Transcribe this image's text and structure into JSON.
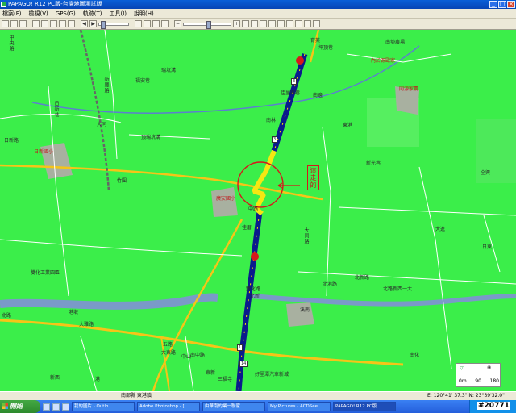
{
  "window": {
    "title": "PAPAGO! R12 PC版-台灣地圖測試版",
    "controls": [
      "minimize",
      "maximize",
      "close"
    ]
  },
  "menu": {
    "items": [
      "檔案(F)",
      "檢視(V)",
      "GPS(G)",
      "軌跡(T)",
      "工具(I)",
      "說明(H)"
    ]
  },
  "map": {
    "labels": [
      {
        "text": "育英",
        "cls": ""
      },
      {
        "text": "中央路",
        "cls": ""
      },
      {
        "text": "頂瑞坑溝",
        "cls": ""
      },
      {
        "text": "新豐路",
        "cls": ""
      },
      {
        "text": "日新路",
        "cls": ""
      },
      {
        "text": "日新國小",
        "cls": "red"
      },
      {
        "text": "日新巷",
        "cls": ""
      },
      {
        "text": "福安巷",
        "cls": ""
      },
      {
        "text": "瑞坑溝",
        "cls": ""
      },
      {
        "text": "坪頂巷",
        "cls": ""
      },
      {
        "text": "大同",
        "cls": ""
      },
      {
        "text": "竹圍",
        "cls": ""
      },
      {
        "text": "廣安國小",
        "cls": "red"
      },
      {
        "text": "南林",
        "cls": ""
      },
      {
        "text": "佳厝",
        "cls": ""
      },
      {
        "text": "中路",
        "cls": ""
      },
      {
        "text": "大同路",
        "cls": ""
      },
      {
        "text": "東港",
        "cls": ""
      },
      {
        "text": "全興",
        "cls": ""
      },
      {
        "text": "大進",
        "cls": ""
      },
      {
        "text": "日東",
        "cls": ""
      },
      {
        "text": "新光巷",
        "cls": ""
      },
      {
        "text": "南邊",
        "cls": ""
      },
      {
        "text": "南勢農場",
        "cls": ""
      },
      {
        "text": "內於源歐家",
        "cls": "red"
      },
      {
        "text": "同源家農",
        "cls": "red"
      },
      {
        "text": "佳里興巷",
        "cls": ""
      },
      {
        "text": "溪南",
        "cls": ""
      },
      {
        "text": "北路",
        "cls": ""
      },
      {
        "text": "大東路",
        "cls": ""
      },
      {
        "text": "北新",
        "cls": ""
      },
      {
        "text": "雙化路",
        "cls": ""
      },
      {
        "text": "雙化工業園區",
        "cls": ""
      },
      {
        "text": "南中路",
        "cls": ""
      },
      {
        "text": "北港路",
        "cls": ""
      },
      {
        "text": "北路新西一大",
        "cls": ""
      },
      {
        "text": "港墘",
        "cls": ""
      },
      {
        "text": "北新路",
        "cls": ""
      },
      {
        "text": "南化",
        "cls": ""
      },
      {
        "text": "好里潭汽車新城",
        "cls": ""
      },
      {
        "text": "東新",
        "cls": ""
      },
      {
        "text": "中山",
        "cls": ""
      },
      {
        "text": "五路",
        "cls": ""
      },
      {
        "text": "新西",
        "cls": ""
      },
      {
        "text": "港",
        "cls": ""
      },
      {
        "text": "三福寺",
        "cls": ""
      },
      {
        "text": "大雅路",
        "cls": ""
      }
    ],
    "annotation_text": "這走的",
    "route_badges": [
      "3",
      "3",
      "1",
      "14"
    ],
    "scale": {
      "values": [
        "0m",
        "90",
        "180"
      ]
    }
  },
  "status": {
    "road": "南部縣 東港鎮",
    "coords": "E: 120°41' 37.3\"  N: 23°39'32.0\""
  },
  "taskbar": {
    "start_label": "開始",
    "tasks": [
      "我的圖片 - Outlo...",
      "Adobe Photoshop - [...",
      "由華南的業一聯家...",
      "My Pictures - ACDSee...",
      "PAPAGO! R12 PC版..."
    ]
  },
  "watermark": "#20771",
  "colors": {
    "map_bg": "#3bee4a",
    "route": "#0a1a8c",
    "route_highlight": "#f5e712",
    "road_major": "#f5c518",
    "river": "#7a9ac8"
  }
}
